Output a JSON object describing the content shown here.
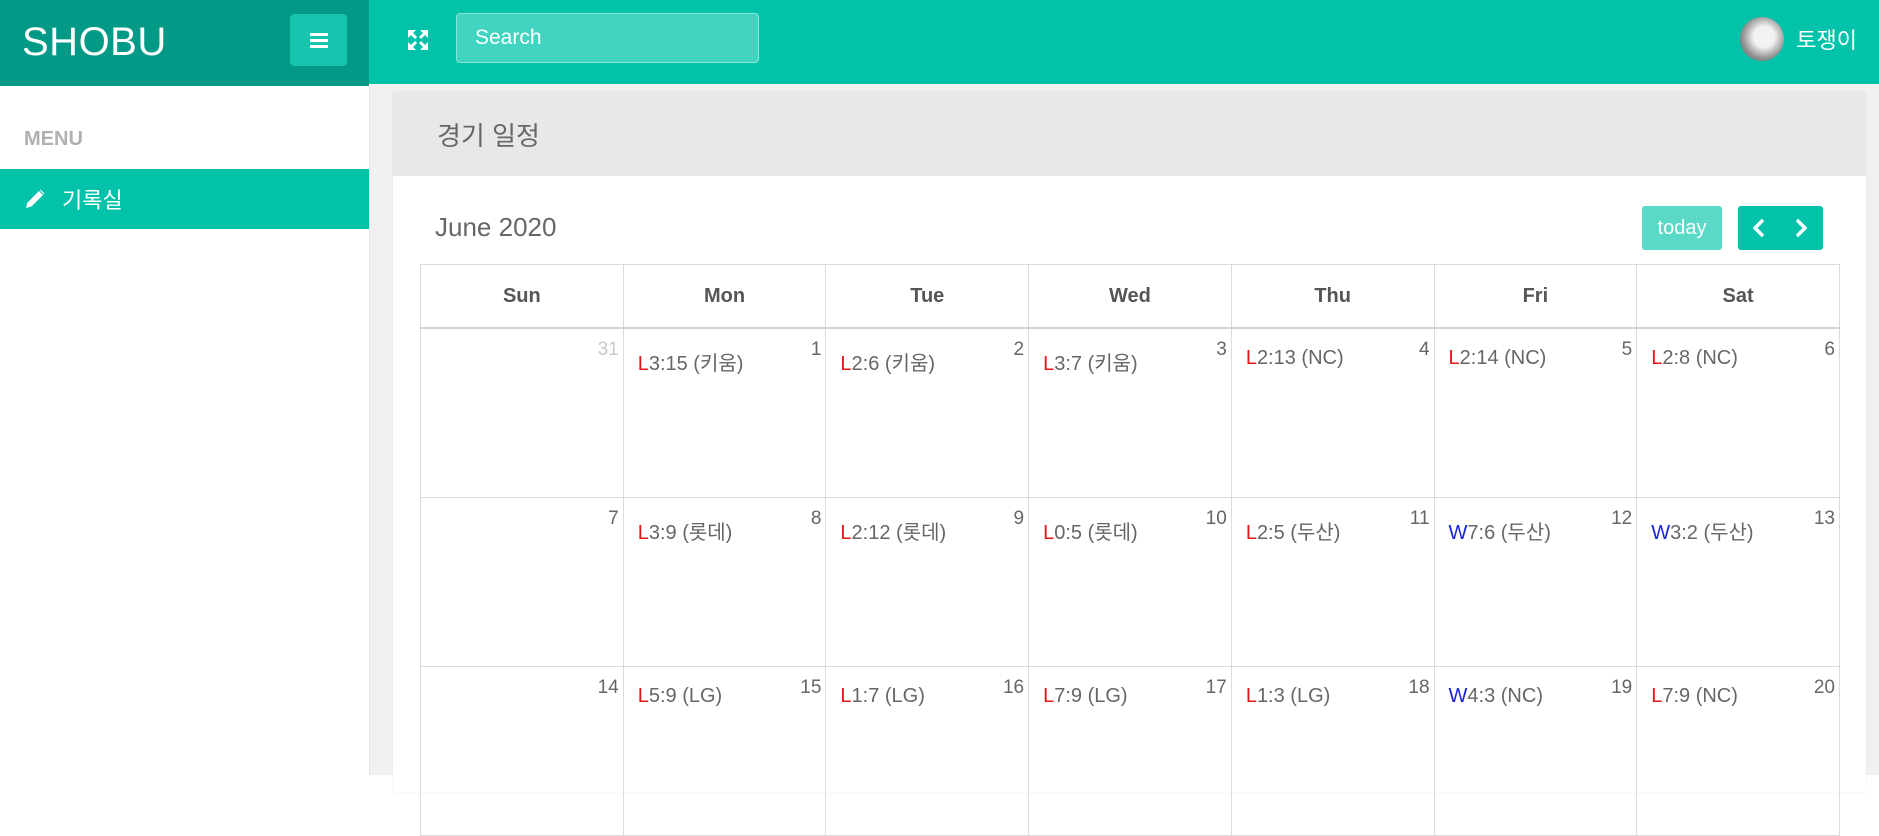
{
  "brand": {
    "name": "SHOBU"
  },
  "topbar": {
    "search_placeholder": "Search",
    "user_name": "토쟁이"
  },
  "sidebar": {
    "heading": "MENU",
    "items": [
      {
        "label": "기록실",
        "icon": "pencil-icon"
      }
    ]
  },
  "page": {
    "title": "경기 일정"
  },
  "calendar": {
    "month_label": "June 2020",
    "today_label": "today",
    "colors": {
      "loss": "#e21818",
      "win": "#1a23d6",
      "accent": "#03c2aa"
    },
    "weekdays": [
      "Sun",
      "Mon",
      "Tue",
      "Wed",
      "Thu",
      "Fri",
      "Sat"
    ],
    "weeks": [
      [
        {
          "day": "31",
          "other_month": true
        },
        {
          "day": "1",
          "result": "L",
          "score": "3:15 (키움)"
        },
        {
          "day": "2",
          "result": "L",
          "score": "2:6 (키움)"
        },
        {
          "day": "3",
          "result": "L",
          "score": "3:7 (키움)"
        },
        {
          "day": "4",
          "result": "L",
          "score": "2:13 (NC)"
        },
        {
          "day": "5",
          "result": "L",
          "score": "2:14 (NC)"
        },
        {
          "day": "6",
          "result": "L",
          "score": "2:8 (NC)"
        }
      ],
      [
        {
          "day": "7"
        },
        {
          "day": "8",
          "result": "L",
          "score": "3:9 (롯데)"
        },
        {
          "day": "9",
          "result": "L",
          "score": "2:12 (롯데)"
        },
        {
          "day": "10",
          "result": "L",
          "score": "0:5 (롯데)"
        },
        {
          "day": "11",
          "result": "L",
          "score": "2:5 (두산)"
        },
        {
          "day": "12",
          "result": "W",
          "score": "7:6 (두산)"
        },
        {
          "day": "13",
          "result": "W",
          "score": "3:2 (두산)"
        }
      ],
      [
        {
          "day": "14"
        },
        {
          "day": "15",
          "result": "L",
          "score": "5:9 (LG)"
        },
        {
          "day": "16",
          "result": "L",
          "score": "1:7 (LG)"
        },
        {
          "day": "17",
          "result": "L",
          "score": "7:9 (LG)"
        },
        {
          "day": "18",
          "result": "L",
          "score": "1:3 (LG)"
        },
        {
          "day": "19",
          "result": "W",
          "score": "4:3 (NC)"
        },
        {
          "day": "20",
          "result": "L",
          "score": "7:9 (NC)"
        }
      ]
    ]
  }
}
